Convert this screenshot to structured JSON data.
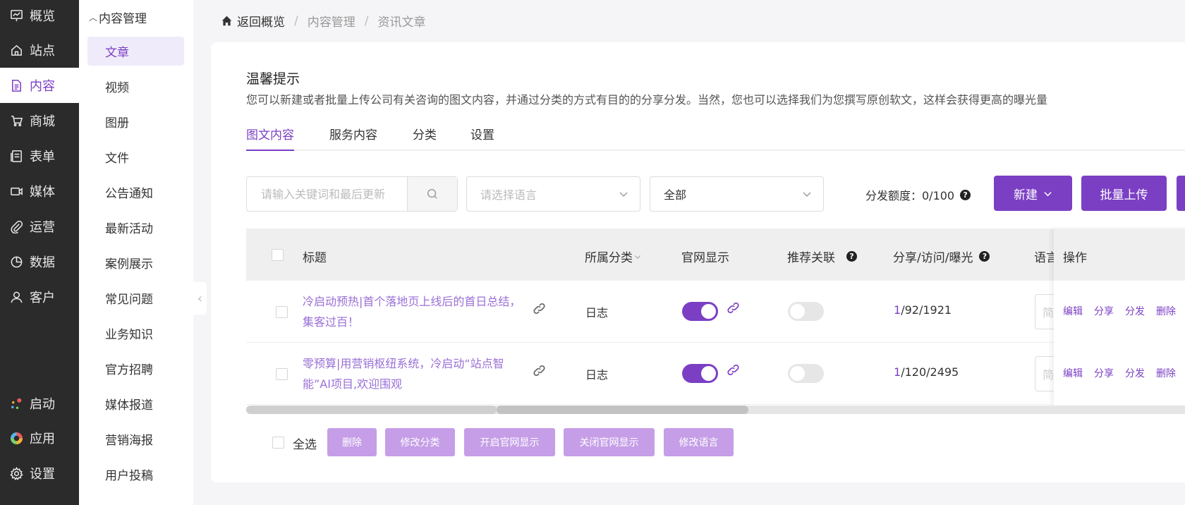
{
  "nav": {
    "items": [
      {
        "label": "概览",
        "icon": "chart-icon"
      },
      {
        "label": "站点",
        "icon": "home-icon"
      },
      {
        "label": "内容",
        "icon": "document-icon"
      },
      {
        "label": "商城",
        "icon": "cart-icon"
      },
      {
        "label": "表单",
        "icon": "form-icon"
      },
      {
        "label": "媒体",
        "icon": "video-icon"
      },
      {
        "label": "运营",
        "icon": "paperclip-icon"
      },
      {
        "label": "数据",
        "icon": "pie-icon"
      },
      {
        "label": "客户",
        "icon": "user-icon"
      }
    ],
    "bottom": [
      {
        "label": "启动",
        "icon": "dots-icon"
      },
      {
        "label": "应用",
        "icon": "apps-icon"
      },
      {
        "label": "设置",
        "icon": "gear-icon"
      }
    ],
    "active_color": "#7b3fc4"
  },
  "subnav": {
    "header": "内容管理",
    "items": [
      "文章",
      "视频",
      "图册",
      "文件",
      "公告通知",
      "最新活动",
      "案例展示",
      "常见问题",
      "业务知识",
      "官方招聘",
      "媒体报道",
      "营销海报",
      "用户投稿"
    ]
  },
  "breadcrumb": {
    "home": "返回概览",
    "level1": "内容管理",
    "level2": "资讯文章"
  },
  "tip": {
    "title": "温馨提示",
    "text": "您可以新建或者批量上传公司有关咨询的图文内容，并通过分类的方式有目的的分享分发。当然，您也可以选择我们为您撰写原创软文，这样会获得更高的曝光量"
  },
  "tabs": [
    "图文内容",
    "服务内容",
    "分类",
    "设置"
  ],
  "filters": {
    "search_placeholder": "请输入关键词和最后更新",
    "language_placeholder": "请选择语言",
    "status_value": "全部"
  },
  "quota": {
    "label": "分发额度：0/100"
  },
  "buttons": {
    "new": "新建",
    "bulk_upload": "批量上传"
  },
  "table": {
    "headers": {
      "title": "标题",
      "category": "所属分类",
      "site_display": "官网显示",
      "related": "推荐关联",
      "stats": "分享/访问/曝光",
      "language": "语言",
      "ops": "操作"
    },
    "rows": [
      {
        "title": "冷启动预热|首个落地页上线后的首日总结，集客过百！",
        "category": "日志",
        "site_display": true,
        "related": false,
        "share": "1",
        "rest": "/92/1921",
        "lang": "简"
      },
      {
        "title": "零预算|用营销枢纽系统，冷启动“站点智能”AI项目,欢迎围观",
        "category": "日志",
        "site_display": true,
        "related": false,
        "share": "1",
        "rest": "/120/2495",
        "lang": "简"
      }
    ],
    "ops": [
      "编辑",
      "分享",
      "分发",
      "删除"
    ]
  },
  "bulk": {
    "select_all": "全选",
    "actions": [
      "删除",
      "修改分类",
      "开启官网显示",
      "关闭官网显示",
      "修改语言"
    ]
  }
}
